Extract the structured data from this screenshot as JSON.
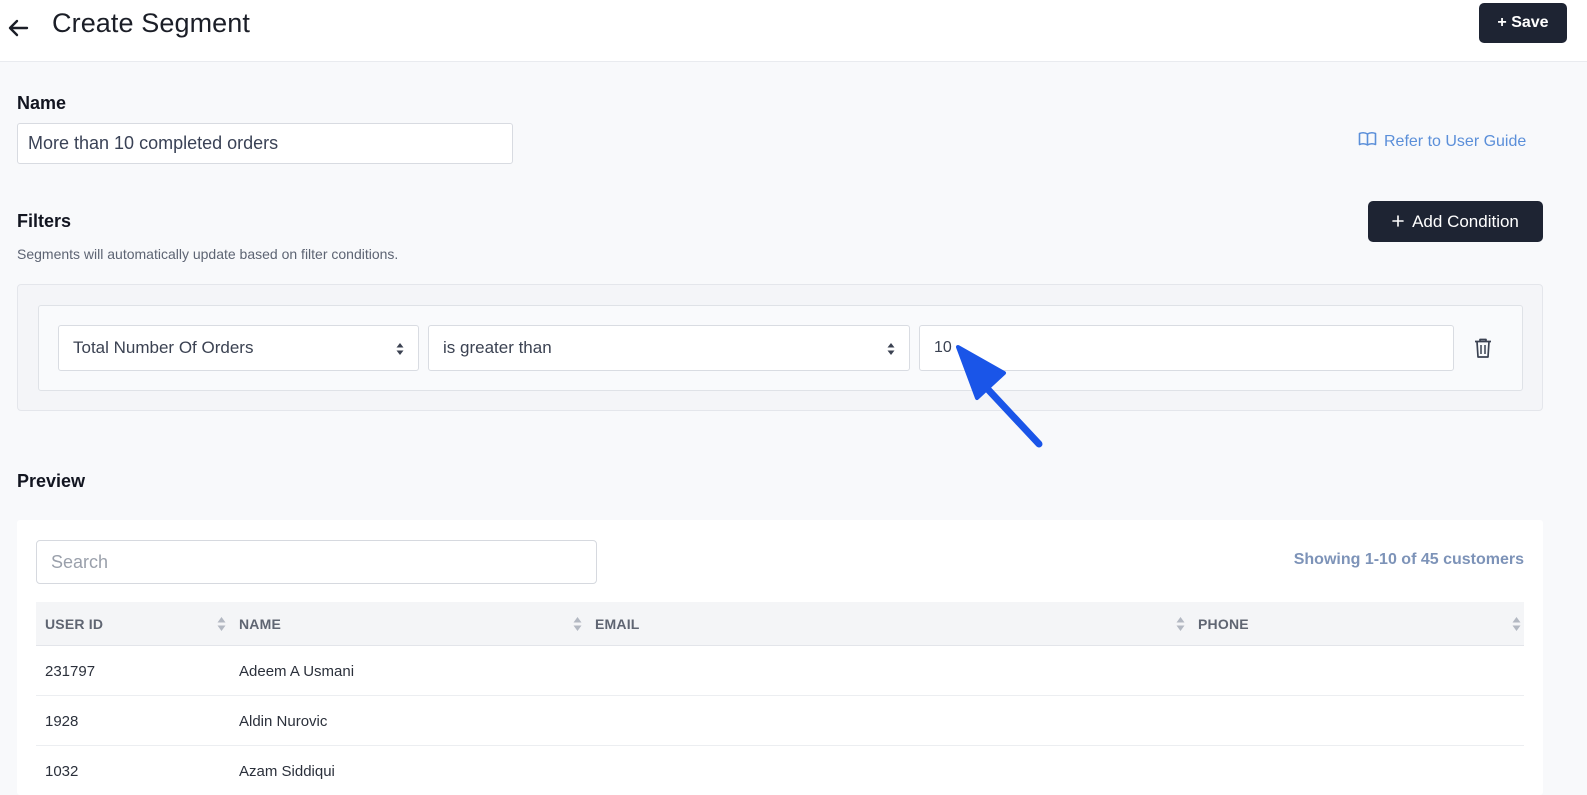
{
  "header": {
    "title": "Create Segment",
    "save_label": "+ Save"
  },
  "name_section": {
    "label": "Name",
    "value": "More than 10 completed orders",
    "guide_link": "Refer to User Guide"
  },
  "filters": {
    "label": "Filters",
    "description": "Segments will automatically update based on filter conditions.",
    "add_label": "Add Condition",
    "condition": {
      "field": "Total Number Of Orders",
      "operator": "is greater than",
      "value": "10"
    }
  },
  "preview": {
    "label": "Preview",
    "search_placeholder": "Search",
    "showing": "Showing 1-10 of 45 customers",
    "columns": [
      "USER ID",
      "NAME",
      "EMAIL",
      "PHONE"
    ],
    "rows": [
      {
        "user_id": "231797",
        "name": "Adeem A Usmani",
        "email": "",
        "phone": ""
      },
      {
        "user_id": "1928",
        "name": "Aldin Nurovic",
        "email": "",
        "phone": ""
      },
      {
        "user_id": "1032",
        "name": "Azam Siddiqui",
        "email": "",
        "phone": ""
      }
    ]
  },
  "colors": {
    "dark_button": "#1e2433",
    "link": "#5b8fd9",
    "annotation_arrow": "#1a55e8"
  },
  "icons": {
    "back": "arrow-left-icon",
    "guide": "book-open-icon",
    "add": "plus-icon",
    "delete": "trash-icon",
    "sort": "sort-icon",
    "select_caret": "caret-updown-icon"
  }
}
